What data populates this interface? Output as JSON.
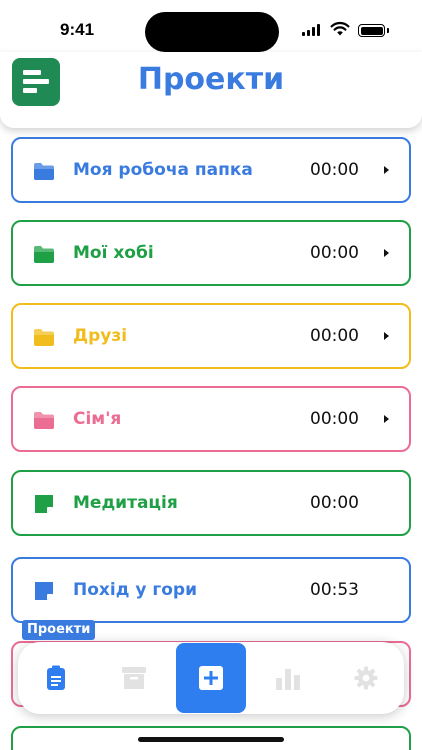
{
  "status_bar": {
    "time": "9:41"
  },
  "header": {
    "title": "Проекти",
    "menu_icon": "menu-icon",
    "menu_color": "#1f8a53",
    "title_color": "#3a7be0"
  },
  "projects": [
    {
      "name": "Моя робоча папка",
      "time": "00:00",
      "color": "#3a7be0",
      "icon": "folder-icon",
      "has_arrow": true
    },
    {
      "name": "Мої хобі",
      "time": "00:00",
      "color": "#20a046",
      "icon": "folder-icon",
      "has_arrow": true
    },
    {
      "name": "Друзі",
      "time": "00:00",
      "color": "#f0bd1c",
      "icon": "folder-icon",
      "has_arrow": true
    },
    {
      "name": "Сім'я",
      "time": "00:00",
      "color": "#ec6d94",
      "icon": "folder-icon",
      "has_arrow": true
    },
    {
      "name": "Медитація",
      "time": "00:00",
      "color": "#20a046",
      "icon": "note-icon",
      "has_arrow": false
    },
    {
      "name": "Похід у гори",
      "time": "00:53",
      "color": "#3a7be0",
      "icon": "note-icon",
      "has_arrow": false
    }
  ],
  "tab_badge": "Проекти",
  "bottom_nav": {
    "items": [
      {
        "name": "projects-tab",
        "icon": "clipboard-icon",
        "active": true
      },
      {
        "name": "archive-tab",
        "icon": "archive-icon",
        "active": false
      },
      {
        "name": "add-tab",
        "icon": "plus-icon",
        "active": false
      },
      {
        "name": "stats-tab",
        "icon": "bar-chart-icon",
        "active": false
      },
      {
        "name": "settings-tab",
        "icon": "gear-icon",
        "active": false
      }
    ],
    "active_color": "#2f7ef0",
    "inactive_color": "#e2e2e2"
  }
}
